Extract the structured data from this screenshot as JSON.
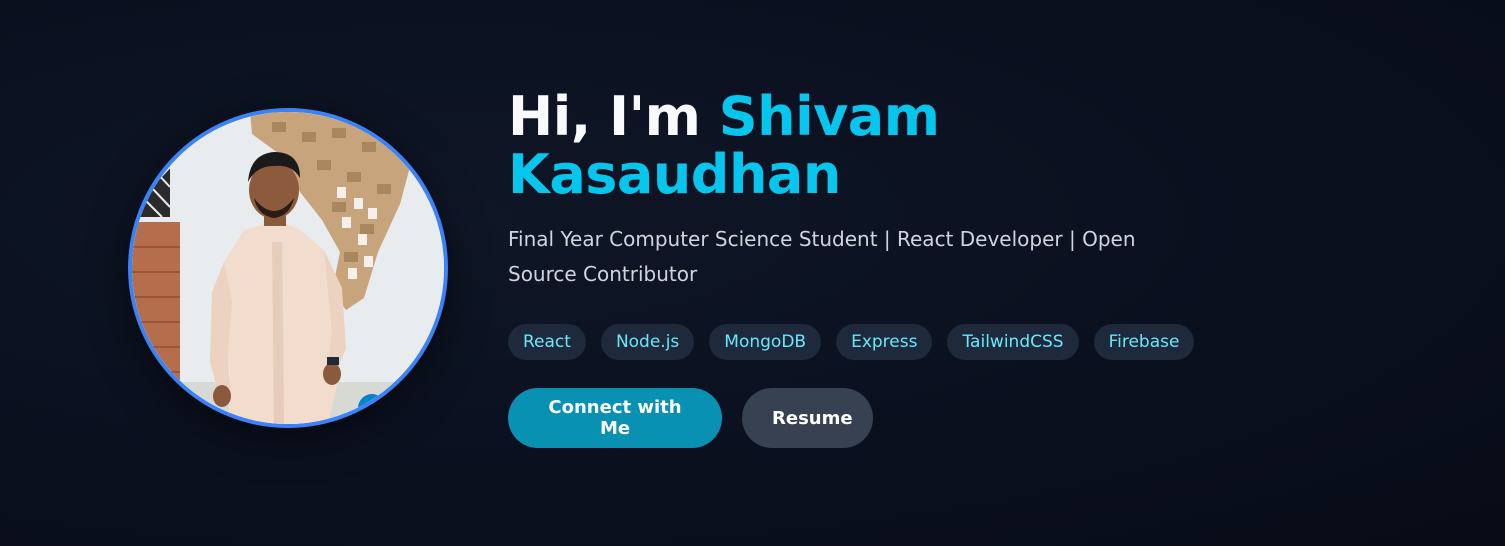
{
  "hero": {
    "greeting": "Hi, I'm",
    "name_first": "Shivam",
    "name_last": "Kasaudhan",
    "subtitle": "Final Year Computer Science Student | React Developer | Open Source Contributor",
    "tags": [
      "React",
      "Node.js",
      "MongoDB",
      "Express",
      "TailwindCSS",
      "Firebase"
    ],
    "primary_button": "Connect with Me",
    "secondary_button": "Resume"
  },
  "colors": {
    "background": "#0b1120",
    "accent": "#06c6ee",
    "avatar_border": "#3b82f6",
    "tag_background": "#1e293b",
    "tag_text": "#67e8f9",
    "primary_button": "#0891b2",
    "secondary_button": "#374151"
  },
  "icons": {
    "avatar": "profile-photo"
  }
}
